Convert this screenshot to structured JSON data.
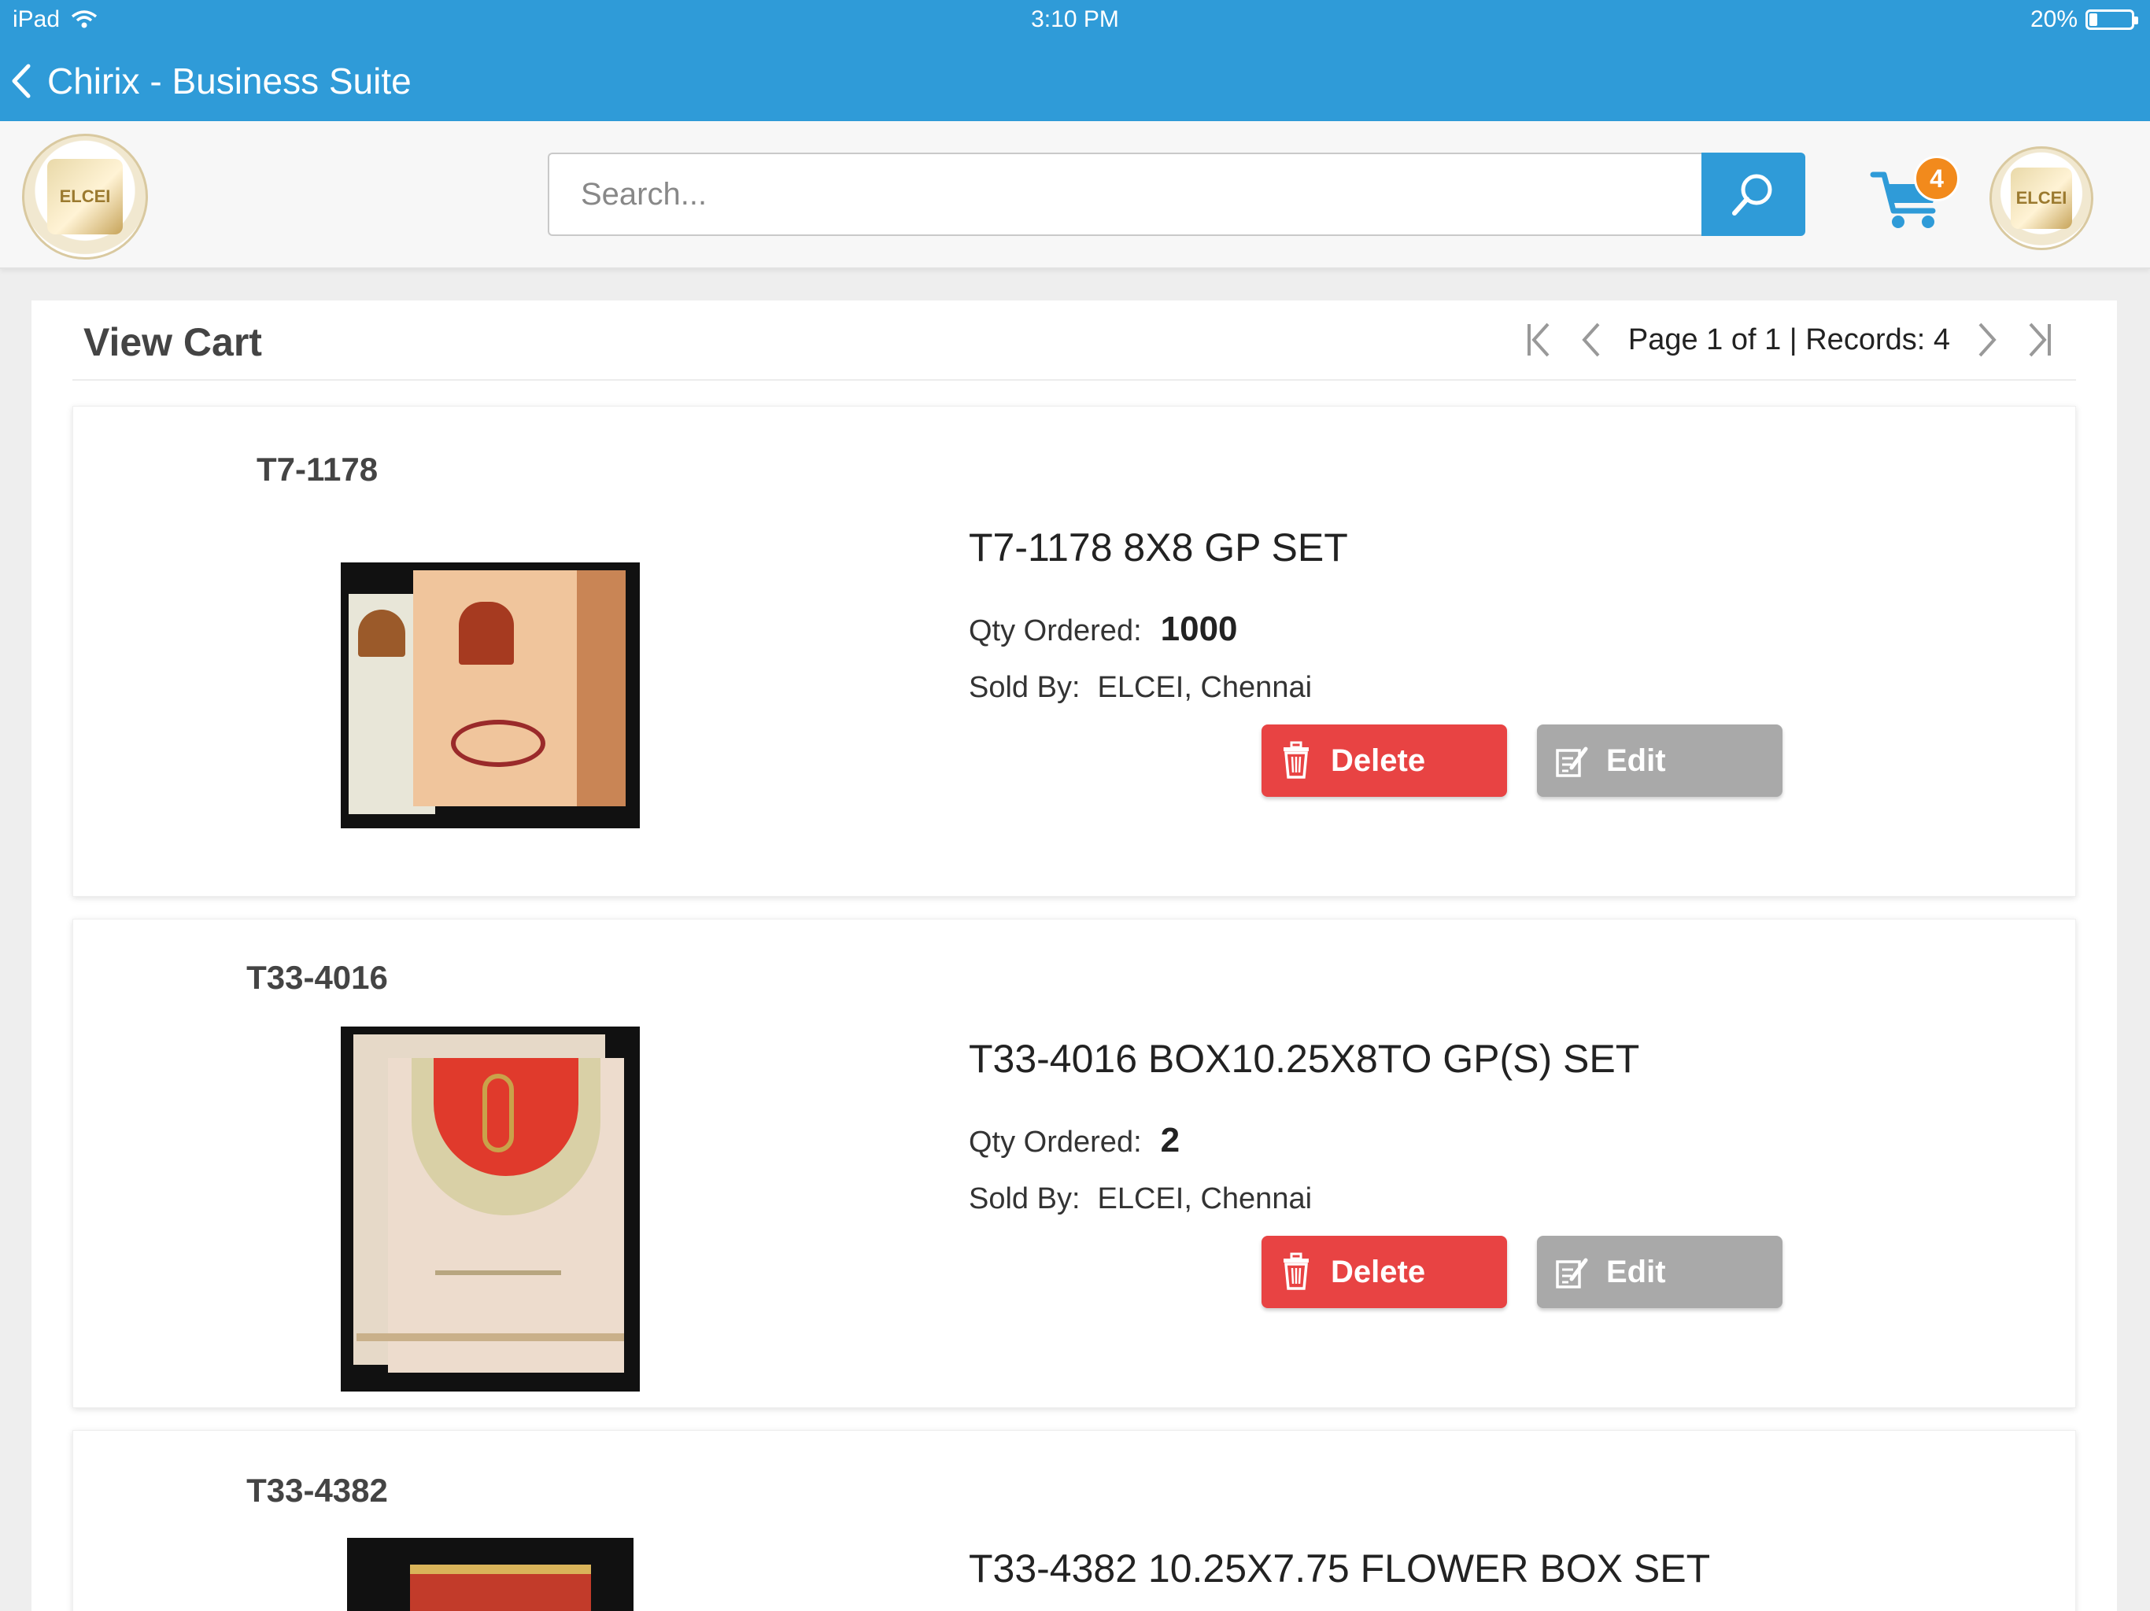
{
  "status_bar": {
    "device": "iPad",
    "time": "3:10 PM",
    "battery": "20%"
  },
  "nav": {
    "title": "Chirix - Business Suite"
  },
  "header": {
    "logo_text": "ELCEI",
    "search_placeholder": "Search...",
    "cart_count": "4"
  },
  "cart": {
    "title": "View Cart",
    "pager_text": "Page 1 of 1 | Records: 4",
    "qty_label": "Qty Ordered:",
    "sold_label": "Sold By:",
    "delete_label": "Delete",
    "edit_label": "Edit",
    "items": [
      {
        "code": "T7-1178",
        "name": "T7-1178 8X8 GP SET",
        "qty": "1000",
        "seller": "ELCEI, Chennai"
      },
      {
        "code": "T33-4016",
        "name": "T33-4016 BOX10.25X8TO GP(S) SET",
        "qty": "2",
        "seller": "ELCEI, Chennai"
      },
      {
        "code": "T33-4382",
        "name": "T33-4382 10.25X7.75 FLOWER BOX SET"
      }
    ]
  },
  "colors": {
    "brand_blue": "#2f9bd8",
    "delete_red": "#e84343",
    "edit_gray": "#a9a9a9",
    "badge_orange": "#f28a1c"
  }
}
